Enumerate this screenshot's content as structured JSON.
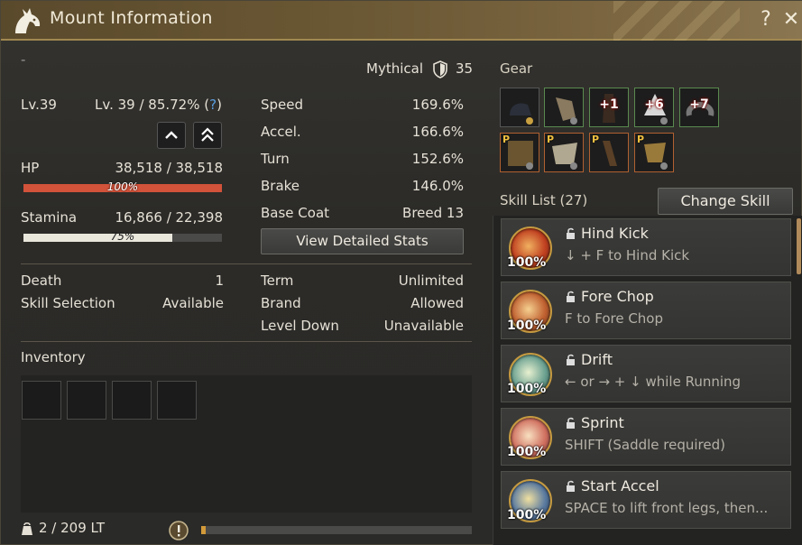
{
  "window": {
    "title": "Mount Information",
    "help": "?",
    "close": "✕"
  },
  "top_left_mark": "-",
  "grade": {
    "label": "Mythical",
    "value": "35"
  },
  "level": {
    "label": "Lv.39",
    "value": "Lv. 39 / 85.72% (",
    "help": "?",
    "close_paren": ")"
  },
  "hp": {
    "label": "HP",
    "value": "38,518 / 38,518",
    "percent_text": "100%",
    "percent": 100,
    "color": "#d2523a"
  },
  "stamina": {
    "label": "Stamina",
    "value": "16,866 / 22,398",
    "percent_text": "75%",
    "percent": 75,
    "color": "#e9e6dc"
  },
  "stats": [
    {
      "label": "Speed",
      "value": "169.6%"
    },
    {
      "label": "Accel.",
      "value": "166.6%"
    },
    {
      "label": "Turn",
      "value": "152.6%"
    },
    {
      "label": "Brake",
      "value": "146.0%"
    },
    {
      "label": "Base Coat",
      "value": "Breed 13"
    }
  ],
  "view_stats_button": "View Detailed Stats",
  "info_left": [
    {
      "label": "Death",
      "value": "1"
    },
    {
      "label": "Skill Selection",
      "value": "Available"
    }
  ],
  "info_right": [
    {
      "label": "Term",
      "value": "Unlimited"
    },
    {
      "label": "Brand",
      "value": "Allowed"
    },
    {
      "label": "Level Down",
      "value": "Unavailable"
    }
  ],
  "inventory": {
    "title": "Inventory",
    "capacity": "2 / 209 LT",
    "capacity_fraction": 0.017
  },
  "gear": {
    "title": "Gear",
    "row1": [
      {
        "name": "saddle-icon",
        "plus": ""
      },
      {
        "name": "stirrups-icon",
        "plus": ""
      },
      {
        "name": "barding-icon",
        "plus": "+1"
      },
      {
        "name": "champron-icon",
        "plus": "+6"
      },
      {
        "name": "horseshoe-icon",
        "plus": "+7"
      }
    ],
    "row2": [
      {
        "name": "premium-saddle-icon",
        "mark": "P"
      },
      {
        "name": "premium-barding-icon",
        "mark": "P"
      },
      {
        "name": "premium-stirrups-icon",
        "mark": "P"
      },
      {
        "name": "premium-horseshoe-icon",
        "mark": "P"
      }
    ]
  },
  "skills": {
    "title": "Skill List (27)",
    "change_button": "Change Skill",
    "items": [
      {
        "name": "Hind Kick",
        "desc": "↓ + F to Hind Kick",
        "pct": "100%"
      },
      {
        "name": "Fore Chop",
        "desc": "F to Fore Chop",
        "pct": "100%"
      },
      {
        "name": "Drift",
        "desc": "← or → + ↓ while Running",
        "pct": "100%"
      },
      {
        "name": "Sprint",
        "desc": "SHIFT (Saddle required)",
        "pct": "100%"
      },
      {
        "name": "Start Accel",
        "desc": "SPACE to lift front legs, then...",
        "pct": "100%"
      }
    ]
  },
  "colors": {
    "accent_gold": "#c59a40",
    "title_bar": "#6b5834",
    "help_blue": "#5aa0e0"
  }
}
